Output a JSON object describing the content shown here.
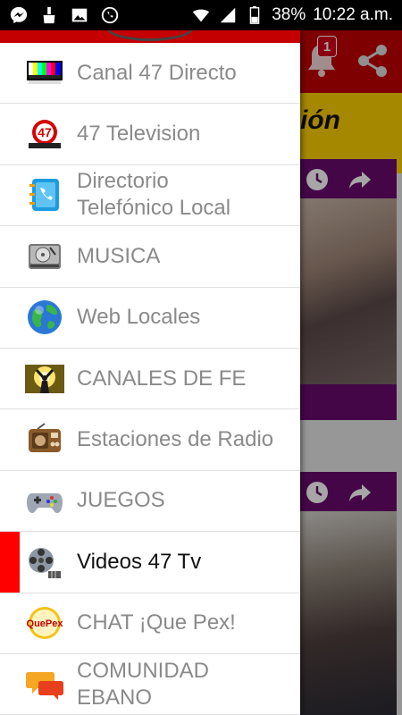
{
  "status_bar": {
    "battery": "38%",
    "time": "10:22 a.m."
  },
  "app": {
    "notification_count": "1",
    "banner_text": "ión"
  },
  "menu": {
    "items": [
      {
        "label": "Canal 47 Directo",
        "icon": "tv-color-bars-icon"
      },
      {
        "label": "47 Television",
        "icon": "47-logo-icon"
      },
      {
        "label": "Directorio\nTelefónico Local",
        "icon": "phone-book-icon"
      },
      {
        "label": "MUSICA",
        "icon": "hard-drive-icon"
      },
      {
        "label": "Web Locales",
        "icon": "globe-icon"
      },
      {
        "label": "CANALES DE FE",
        "icon": "worship-icon"
      },
      {
        "label": "Estaciones de Radio",
        "icon": "radio-icon"
      },
      {
        "label": "JUEGOS",
        "icon": "gamepad-icon"
      },
      {
        "label": "Videos 47 Tv",
        "icon": "film-reel-icon",
        "active": true
      },
      {
        "label": "CHAT ¡Que Pex!",
        "icon": "quepex-logo-icon"
      },
      {
        "label": "COMUNIDAD\nEBANO",
        "icon": "chat-bubbles-icon"
      }
    ]
  },
  "colors": {
    "accent_red": "#c40000",
    "active_marker": "#ff0000",
    "card_purple": "#6a0a6e",
    "banner_yellow": "#ffd100"
  }
}
